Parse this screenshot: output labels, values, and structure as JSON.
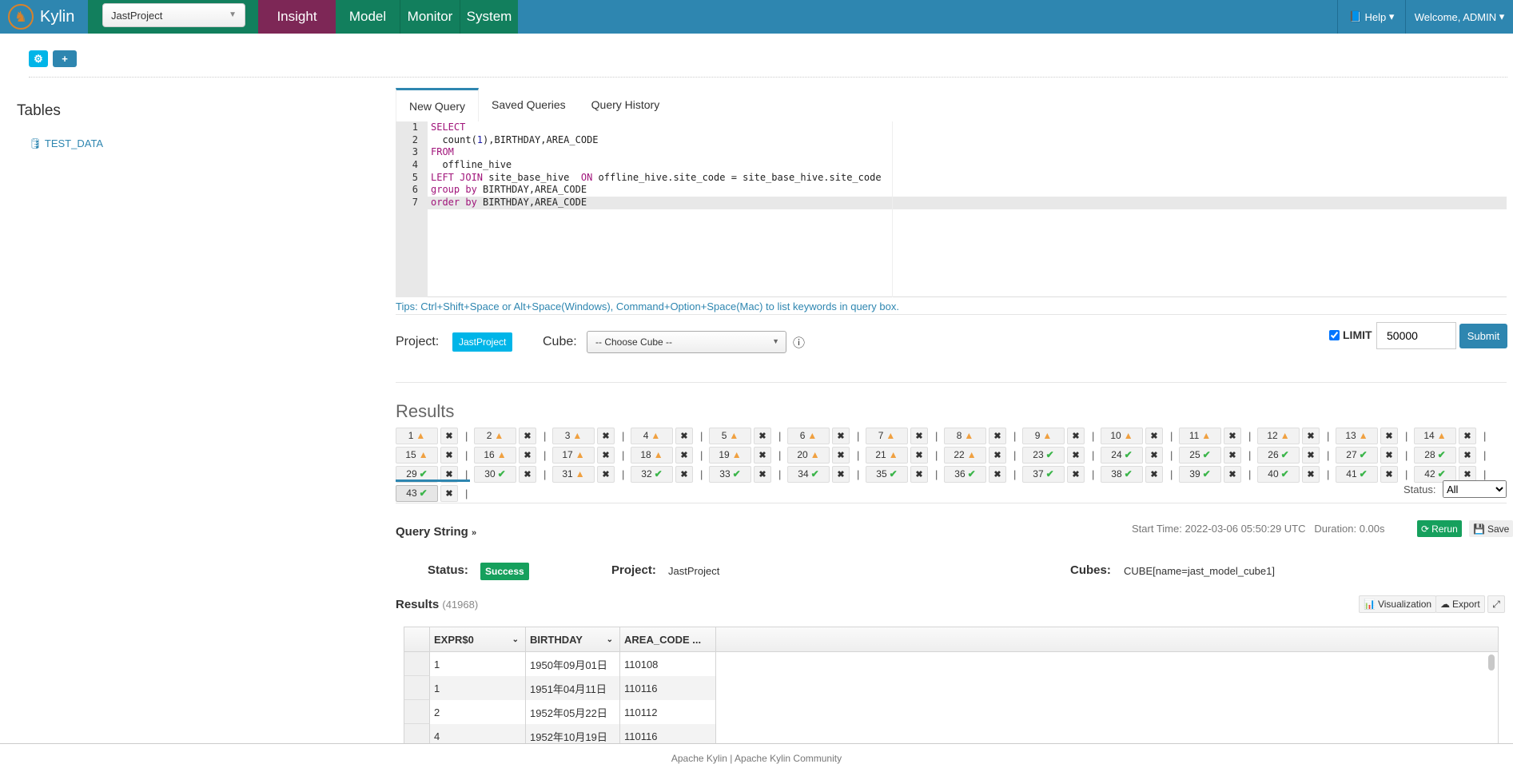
{
  "nav": {
    "brand": "Kylin",
    "project": "JastProject",
    "items": [
      "Insight",
      "Model",
      "Monitor",
      "System"
    ],
    "active": "Insight",
    "help": "Help",
    "user": "Welcome, ADMIN",
    "colors": {
      "bar": "#2e86b0",
      "green": "#127f5d",
      "active": "#7d2756"
    }
  },
  "sidebar": {
    "title": "Tables",
    "tables": [
      "TEST_DATA"
    ]
  },
  "tabs": [
    "New Query",
    "Saved Queries",
    "Query History"
  ],
  "editor": {
    "lines": [
      [
        {
          "t": "SELECT",
          "c": "kw"
        }
      ],
      [
        {
          "t": "  count("
        },
        {
          "t": "1",
          "c": "num"
        },
        {
          "t": "),BIRTHDAY,AREA_CODE"
        }
      ],
      [
        {
          "t": "FROM",
          "c": "kw"
        }
      ],
      [
        {
          "t": "  offline_hive"
        }
      ],
      [
        {
          "t": "LEFT JOIN",
          "c": "kw"
        },
        {
          "t": " site_base_hive  "
        },
        {
          "t": "ON",
          "c": "kw"
        },
        {
          "t": " offline_hive.site_code = site_base_hive.site_code"
        }
      ],
      [
        {
          "t": "group by",
          "c": "kw"
        },
        {
          "t": " BIRTHDAY,AREA_CODE"
        }
      ],
      [
        {
          "t": "order by",
          "c": "kw"
        },
        {
          "t": " BIRTHDAY,AREA_CODE"
        }
      ]
    ]
  },
  "tips": "Tips: Ctrl+Shift+Space or Alt+Space(Windows), Command+Option+Space(Mac) to list keywords in query box.",
  "form": {
    "project_label": "Project:",
    "project": "JastProject",
    "cube_label": "Cube:",
    "cube_placeholder": "-- Choose Cube --",
    "limit_label": "LIMIT",
    "limit_checked": true,
    "limit": "50000",
    "submit": "Submit"
  },
  "results_title": "Results",
  "results": {
    "warning": [
      1,
      2,
      3,
      4,
      5,
      6,
      7,
      8,
      9,
      10,
      11,
      12,
      13,
      14,
      15,
      16,
      17,
      18,
      19,
      20,
      21,
      22,
      31
    ],
    "count": 43,
    "selected": 43,
    "status_label": "Status:",
    "status_value": "All"
  },
  "query": {
    "title": "Query String",
    "start_time": "Start Time: 2022-03-06 05:50:29 UTC",
    "duration": "Duration: 0.00s",
    "rerun": "Rerun",
    "save": "Save",
    "status_label": "Status:",
    "status": "Success",
    "project_label": "Project:",
    "project": "JastProject",
    "cubes_label": "Cubes:",
    "cubes": "CUBE[name=jast_model_cube1]"
  },
  "table": {
    "title": "Results",
    "count": "(41968)",
    "visualization": "Visualization",
    "export": "Export",
    "columns": [
      "EXPR$0",
      "BIRTHDAY",
      "AREA_CODE ..."
    ],
    "rows": [
      [
        "1",
        "1950年09月01日",
        "110108"
      ],
      [
        "1",
        "1951年04月11日",
        "110116"
      ],
      [
        "2",
        "1952年05月22日",
        "110112"
      ],
      [
        "4",
        "1952年10月19日",
        "110116"
      ]
    ]
  },
  "footer": {
    "left": "Apache Kylin",
    "right": "Apache Kylin Community"
  }
}
